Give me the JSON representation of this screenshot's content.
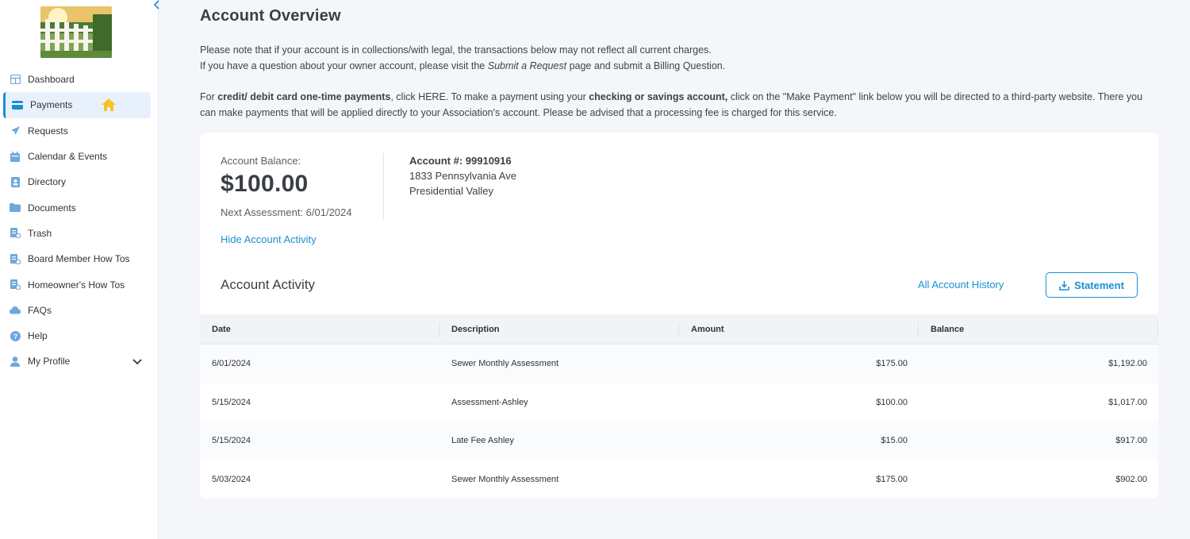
{
  "sidebar": {
    "items": [
      {
        "label": "Dashboard",
        "icon": "dashboard-icon"
      },
      {
        "label": "Payments",
        "icon": "credit-card-icon",
        "active": true
      },
      {
        "label": "Requests",
        "icon": "paper-plane-icon"
      },
      {
        "label": "Calendar & Events",
        "icon": "calendar-icon"
      },
      {
        "label": "Directory",
        "icon": "contact-book-icon"
      },
      {
        "label": "Documents",
        "icon": "folder-icon"
      },
      {
        "label": "Trash",
        "icon": "document-icon"
      },
      {
        "label": "Board Member How Tos",
        "icon": "document-icon"
      },
      {
        "label": "Homeowner's How Tos",
        "icon": "document-icon"
      },
      {
        "label": "FAQs",
        "icon": "cloud-icon"
      },
      {
        "label": "Help",
        "icon": "help-icon"
      },
      {
        "label": "My Profile",
        "icon": "user-icon"
      }
    ]
  },
  "page": {
    "title": "Account Overview",
    "notice": {
      "line1": "Please note that if your account is in collections/with legal, the transactions below may not reflect all current charges.",
      "line2_pre": "If you have a question about your owner account, please visit the ",
      "line2_link": "Submit a Request",
      "line2_post": " page and submit a Billing Question.",
      "line3_pre": "For ",
      "line3_bold1": "credit/ debit card one-time payments",
      "line3_mid": ", click HERE. To make a payment using your ",
      "line3_bold2": "checking or savings account,",
      "line3_post": " click on the \"Make Payment\" link below you will be directed to a third-party website. There you can make payments that will be applied directly to your Association's account. Please be advised that a processing fee is charged for this service."
    }
  },
  "account": {
    "balance_label": "Account Balance:",
    "balance": "$100.00",
    "next_assessment": "Next Assessment: 6/01/2024",
    "number": "Account #: 99910916",
    "address1": "1833 Pennsylvania Ave",
    "address2": "Presidential Valley",
    "hide_link": "Hide Account Activity"
  },
  "activity": {
    "title": "Account Activity",
    "all_history": "All Account History",
    "statement": "Statement",
    "columns": [
      "Date",
      "Description",
      "Amount",
      "Balance"
    ],
    "rows": [
      {
        "date": "6/01/2024",
        "description": "Sewer Monthly Assessment",
        "amount": "$175.00",
        "balance": "$1,192.00"
      },
      {
        "date": "5/15/2024",
        "description": "Assessment-Ashley",
        "amount": "$100.00",
        "balance": "$1,017.00"
      },
      {
        "date": "5/15/2024",
        "description": "Late Fee Ashley",
        "amount": "$15.00",
        "balance": "$917.00"
      },
      {
        "date": "5/03/2024",
        "description": "Sewer Monthly Assessment",
        "amount": "$175.00",
        "balance": "$902.00"
      }
    ]
  },
  "colors": {
    "accent": "#1a8fd1",
    "active_bg": "#e8f1fb",
    "page_bg": "#f4f6f9"
  }
}
